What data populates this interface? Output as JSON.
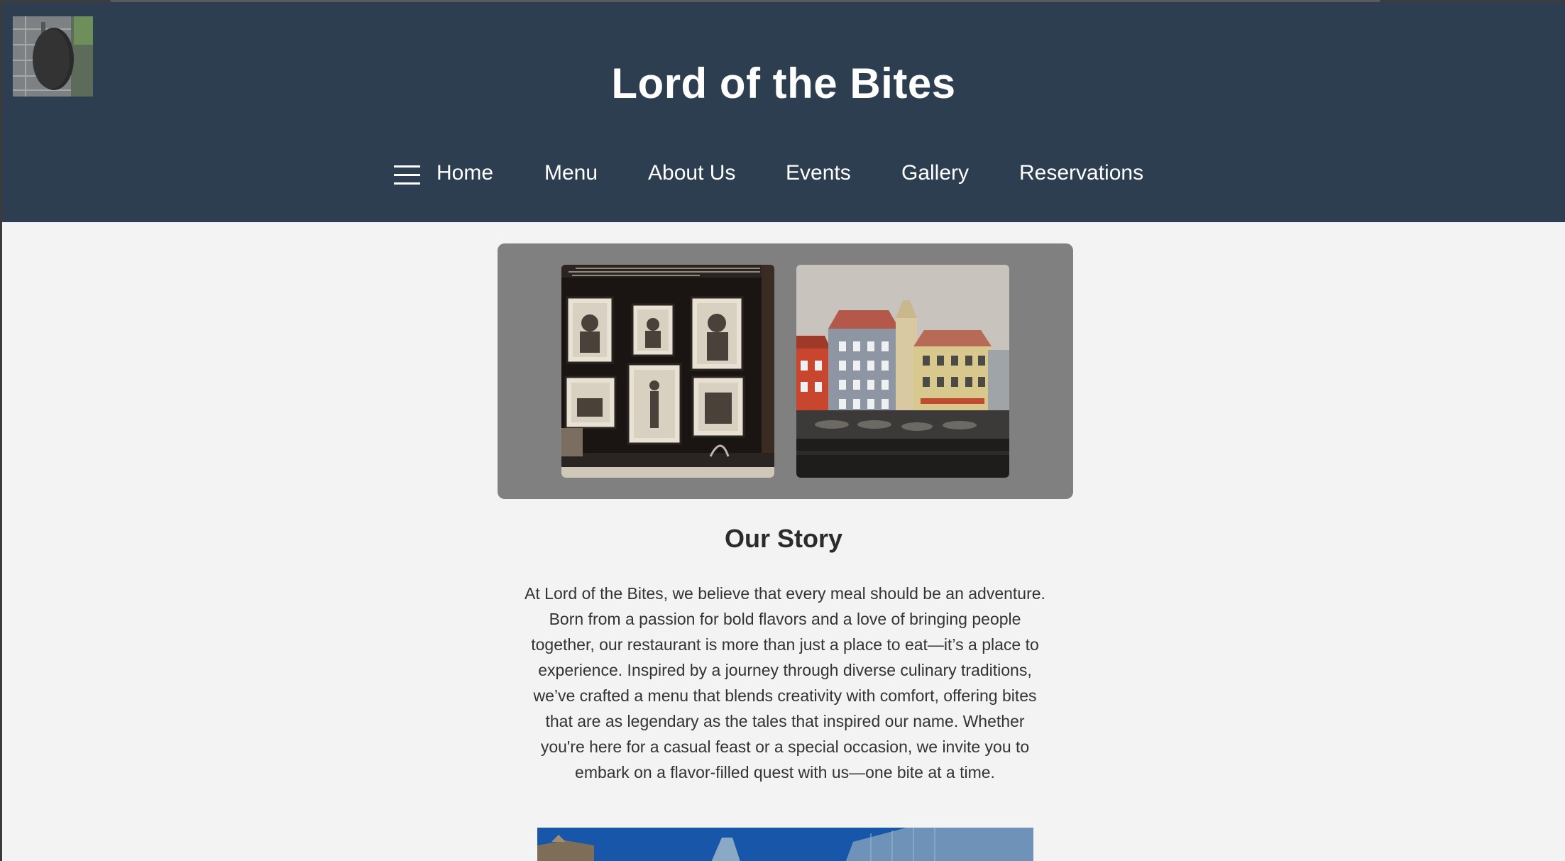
{
  "site": {
    "title": "Lord of the Bites"
  },
  "nav": {
    "items": [
      {
        "label": "Home"
      },
      {
        "label": "Menu"
      },
      {
        "label": "About Us"
      },
      {
        "label": "Events"
      },
      {
        "label": "Gallery"
      },
      {
        "label": "Reservations"
      }
    ]
  },
  "icons": {
    "menu": "hamburger-menu-icon"
  },
  "colors": {
    "header_bg": "#2c3e50",
    "page_bg": "#f3f3f3",
    "gallery_bg": "#808080",
    "nav_text": "#ffffff"
  },
  "story": {
    "title": "Our Story",
    "text": "At Lord of the Bites, we believe that every meal should be an adventure. Born from a passion for bold flavors and a love of bringing people together, our restaurant is more than just a place to eat—it’s a place to experience. Inspired by a journey through diverse culinary traditions, we’ve crafted a menu that blends creativity with comfort, offering bites that are as legendary as the tales that inspired our name. Whether you're here for a casual feast or a special occasion, we invite you to embark on a flavor-filled quest with us—one bite at a time."
  }
}
